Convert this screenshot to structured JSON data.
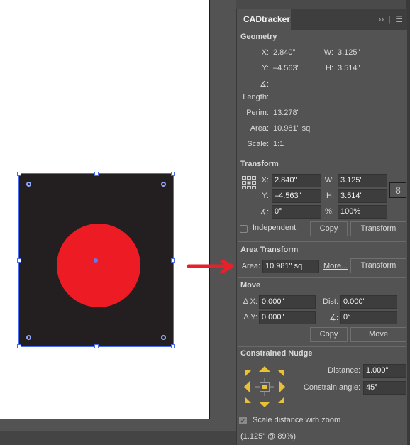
{
  "canvas": {
    "shape_colors": {
      "rect": "#231f20",
      "circle": "#ed1c24",
      "selection": "#4a6cf0",
      "arrow": "#e8202a"
    }
  },
  "panel": {
    "tab_label": "CADtracker",
    "overflow_icon": "double-chevron-right",
    "menu_icon": "hamburger-menu",
    "geometry": {
      "title": "Geometry",
      "x_label": "X:",
      "x_value": "2.840\"",
      "w_label": "W:",
      "w_value": "3.125\"",
      "y_label": "Y:",
      "y_value": "–4.563\"",
      "h_label": "H:",
      "h_value": "3.514\"",
      "angle_label": "∡:",
      "length_label": "Length:",
      "perim_label": "Perim:",
      "perim_value": "13.278\"",
      "area_label": "Area:",
      "area_value": "10.981\" sq",
      "scale_label": "Scale:",
      "scale_value": "1:1"
    },
    "transform": {
      "title": "Transform",
      "x_label": "X:",
      "x_value": "2.840\"",
      "w_label": "W:",
      "w_value": "3.125\"",
      "y_label": "Y:",
      "y_value": "–4.563\"",
      "h_label": "H:",
      "h_value": "3.514\"",
      "angle_label": "∡:",
      "angle_value": "0°",
      "pct_label": "%:",
      "pct_value": "100%",
      "independent_label": "Independent",
      "independent_checked": false,
      "copy_label": "Copy",
      "transform_label": "Transform"
    },
    "area_transform": {
      "title": "Area Transform",
      "area_label": "Area:",
      "area_value": "10.981\" sq",
      "more_label": "More...",
      "transform_label": "Transform"
    },
    "move": {
      "title": "Move",
      "dx_label": "Δ X:",
      "dx_value": "0.000\"",
      "dist_label": "Dist:",
      "dist_value": "0.000\"",
      "dy_label": "Δ Y:",
      "dy_value": "0.000\"",
      "angle_label": "∡:",
      "angle_value": "0°",
      "copy_label": "Copy",
      "move_label": "Move"
    },
    "nudge": {
      "title": "Constrained Nudge",
      "distance_label": "Distance:",
      "distance_value": "1.000\"",
      "angle_label": "Constrain angle:",
      "angle_value": "45°",
      "accent": "#e8c13a",
      "scale_label": "Scale distance with zoom",
      "scale_checked": true,
      "zoom_readout": "(1.125\" @ 89%)"
    }
  }
}
